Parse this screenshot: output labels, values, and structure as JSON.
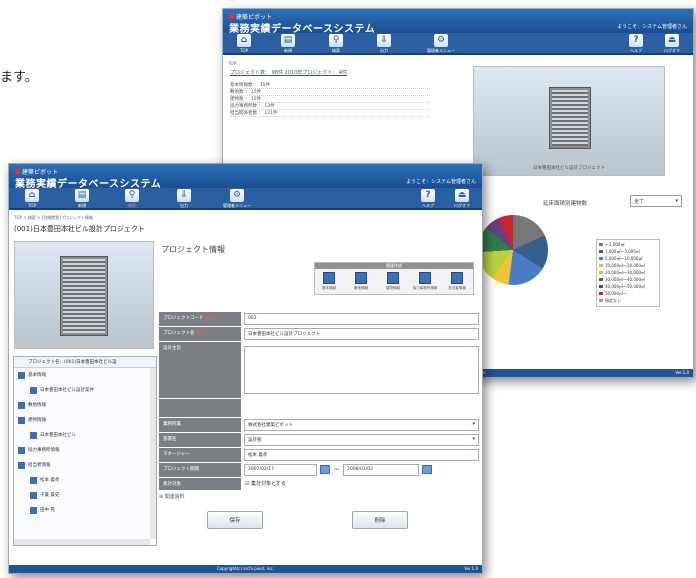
{
  "intro_text": "ます。",
  "app": {
    "logo": "建築ピボット",
    "title": "業務実績データベースシステム",
    "welcome": "ようこそ：システム管理者さん",
    "copyright": "Copyright(c) archi pivot, inc.",
    "version": "Ver.1.0"
  },
  "toolbar": [
    {
      "label": "TOP",
      "icon": "home-icon",
      "glyph": "⌂"
    },
    {
      "label": "新規",
      "icon": "document-icon",
      "glyph": "▤"
    },
    {
      "label": "検索",
      "icon": "search-icon",
      "glyph": "⚲"
    },
    {
      "label": "出力",
      "icon": "export-icon",
      "glyph": "⇩"
    },
    {
      "label": "管理者メニュー",
      "icon": "admin-icon",
      "glyph": "⚙"
    },
    {
      "label": "ヘルプ",
      "icon": "help-icon",
      "glyph": "?"
    },
    {
      "label": "ログオフ",
      "icon": "logoff-icon",
      "glyph": "⏏"
    }
  ],
  "back": {
    "breadcrumb": "TOP",
    "summary": "プロジェクト数： 98件   2010年プロジェクト： 4件",
    "stats": [
      "基本情報数 ： 15件",
      "敷地数 ： 15件",
      "建物数 ： 15件",
      "協力事務所数 ： 13件",
      "担当関係者数 ： 121件"
    ],
    "photo_caption": "日本豊田本社ビル設計プロジェクト",
    "chart_label": "延床面積別建物数",
    "chart_filter": "全て",
    "chart_data": {
      "type": "pie",
      "title": "",
      "categories": [
        "〜1,000㎡",
        "1,000㎡〜5,000㎡",
        "5,000㎡〜10,000㎡",
        "10,000㎡〜20,000㎡",
        "20,000㎡〜30,000㎡",
        "30,000㎡〜40,000㎡",
        "40,000㎡〜50,000㎡",
        "50,000㎡〜",
        "指定なし"
      ],
      "values": [
        18,
        16,
        18,
        8,
        14,
        12,
        7,
        7,
        0
      ],
      "colors": [
        "#777777",
        "#355f8f",
        "#4a7ec4",
        "#f1c232",
        "#b8d13b",
        "#2f7d4a",
        "#6a3f7e",
        "#cc2233",
        "#999999"
      ]
    }
  },
  "front": {
    "breadcrumb": "TOP > 検索 > [詳細閲覧]プロジェクト情報",
    "page_title": "(001)日本豊田本社ビル設計プロジェクト",
    "section_title": "プロジェクト情報",
    "tool_header": "関連作成",
    "tools": [
      "基本情報",
      "敷地情報",
      "建物情報",
      "協力事務所情報",
      "担当者情報"
    ],
    "tree_header": "プロジェクト名：(001)日本豊田本社ビル設",
    "tree": [
      "基本情報",
      "日本豊田本社ビル設計案件",
      "敷地情報",
      "建物情報",
      "日本豊田本社ビル",
      "協力事務所情報",
      "担当者情報",
      "松本 義孝",
      "千葉 貴史",
      "田中 晃"
    ],
    "fields": {
      "code_label": "プロジェクトコード",
      "code_value": "001",
      "name_label": "プロジェクト名",
      "name_value": "日本豊田本社ビル設計プロジェクト",
      "outline_label": "設計主旨",
      "company_label": "業務所属",
      "company_value": "株式会社建築ピボット",
      "dept_label": "部署名",
      "dept_value": "設計部",
      "manager_label": "マネージャー",
      "manager_value": "松本 義孝",
      "period_label": "プロジェクト期間",
      "period_start": "2007/02/17",
      "period_end": "2008/01/02",
      "period_sep": "〜",
      "aggregate_label": "集計対象",
      "aggregate_value": "集計対象とする",
      "required": "必須"
    },
    "related": "関連資料",
    "save": "保存",
    "delete": "削除"
  }
}
